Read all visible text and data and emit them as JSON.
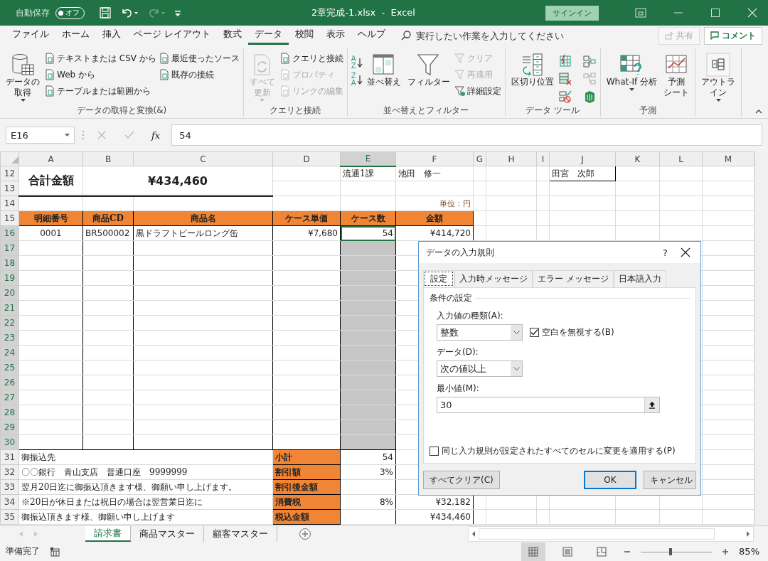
{
  "title_bar": {
    "autosave_label": "自動保存",
    "autosave_toggle": {
      "label": "オフ",
      "on": false
    },
    "title": "2章完成-1.xlsx  -  Excel",
    "signin": "サインイン"
  },
  "menu_tabs": [
    {
      "label": "ファイル",
      "selected": false
    },
    {
      "label": "ホーム",
      "selected": false
    },
    {
      "label": "挿入",
      "selected": false
    },
    {
      "label": "ページ レイアウト",
      "selected": false
    },
    {
      "label": "数式",
      "selected": false
    },
    {
      "label": "データ",
      "selected": true
    },
    {
      "label": "校閲",
      "selected": false
    },
    {
      "label": "表示",
      "selected": false
    },
    {
      "label": "ヘルプ",
      "selected": false
    }
  ],
  "tell_me": {
    "placeholder": "実行したい作業を入力してください"
  },
  "share_button": {
    "label": "共有",
    "disabled": true
  },
  "comment_button": {
    "label": "コメント"
  },
  "ribbon": {
    "groups": [
      {
        "label": "データの取得と変換(&)",
        "large": [
          {
            "lines": [
              "データの",
              "取得"
            ],
            "dropdown": true,
            "disabled": false
          }
        ],
        "small": [
          {
            "label": "テキストまたは CSV から",
            "disabled": false
          },
          {
            "label": "Web から",
            "disabled": false
          },
          {
            "label": "テーブルまたは範囲から",
            "disabled": false
          },
          {
            "label": "最近使ったソース",
            "disabled": false
          },
          {
            "label": "既存の接続",
            "disabled": false
          }
        ]
      },
      {
        "label": "クエリと接続",
        "large": [
          {
            "lines": [
              "すべて",
              "更新"
            ],
            "dropdown": true,
            "disabled": true
          }
        ],
        "small": [
          {
            "label": "クエリと接続",
            "disabled": false
          },
          {
            "label": "プロパティ",
            "disabled": true
          },
          {
            "label": "リンクの編集",
            "disabled": true
          }
        ]
      },
      {
        "label": "並べ替えとフィルター",
        "sort_buttons": [
          {
            "top": "A",
            "bottom": "Z"
          },
          {
            "top": "Z",
            "bottom": "A"
          }
        ],
        "large": [
          {
            "lines": [
              "並べ替え"
            ],
            "dropdown": false,
            "disabled": false
          },
          {
            "lines": [
              "フィルター"
            ],
            "dropdown": false,
            "disabled": false
          }
        ],
        "small": [
          {
            "label": "クリア",
            "disabled": true
          },
          {
            "label": "再適用",
            "disabled": true
          },
          {
            "label": "詳細設定",
            "disabled": false
          }
        ]
      },
      {
        "label": "データ ツール",
        "large": [
          {
            "lines": [
              "区切り位置"
            ],
            "dropdown": false,
            "disabled": false
          }
        ]
      },
      {
        "label": "予測",
        "large": [
          {
            "lines": [
              "What-If 分析"
            ],
            "dropdown": true,
            "disabled": false
          },
          {
            "lines": [
              "予測",
              "シート"
            ],
            "dropdown": false,
            "disabled": false
          }
        ]
      },
      {
        "large": [
          {
            "lines": [
              "アウトラ",
              "イン"
            ],
            "dropdown": true,
            "disabled": false
          }
        ]
      }
    ]
  },
  "formula_bar": {
    "name_box": "E16",
    "function_label": "fx",
    "value": "54"
  },
  "sheet": {
    "columns": [
      {
        "label": "A",
        "selected": false
      },
      {
        "label": "B",
        "selected": false
      },
      {
        "label": "C",
        "selected": false
      },
      {
        "label": "D",
        "selected": false
      },
      {
        "label": "E",
        "selected": true
      },
      {
        "label": "F",
        "selected": false
      },
      {
        "label": "G",
        "selected": false
      },
      {
        "label": "H",
        "selected": false
      },
      {
        "label": "I",
        "selected": false
      },
      {
        "label": "J",
        "selected": false
      },
      {
        "label": "K",
        "selected": false
      },
      {
        "label": "L",
        "selected": false
      },
      {
        "label": "M",
        "selected": false
      }
    ],
    "rows": [
      {
        "number": "12",
        "kind": "top",
        "title": "合計金額",
        "total": "¥434,460",
        "dept": "流通1課",
        "person": "池田　修一",
        "contact": "田宮　次郎",
        "selected": false
      },
      {
        "number": "13",
        "kind": "blank",
        "selected": false
      },
      {
        "number": "14",
        "kind": "unit",
        "unit": "単位：円",
        "selected": false
      },
      {
        "number": "15",
        "kind": "header",
        "cells": [
          "明細番号",
          "商品CD",
          "商品名",
          "ケース単価",
          "ケース数",
          "金額"
        ],
        "selected": false
      },
      {
        "number": "16",
        "kind": "item",
        "cells": [
          "0001",
          "BR500002",
          "黒ドラフトビールロング缶",
          "¥7,680",
          "54",
          "¥414,720"
        ],
        "selected": true
      },
      {
        "number": "17",
        "kind": "item",
        "selected": true
      },
      {
        "number": "18",
        "kind": "item",
        "selected": true
      },
      {
        "number": "19",
        "kind": "item",
        "selected": true
      },
      {
        "number": "20",
        "kind": "item",
        "selected": true
      },
      {
        "number": "21",
        "kind": "item",
        "selected": true
      },
      {
        "number": "22",
        "kind": "item",
        "selected": true
      },
      {
        "number": "23",
        "kind": "item",
        "selected": true
      },
      {
        "number": "24",
        "kind": "item",
        "selected": true
      },
      {
        "number": "25",
        "kind": "item",
        "selected": true
      },
      {
        "number": "26",
        "kind": "item",
        "selected": true
      },
      {
        "number": "27",
        "kind": "item",
        "selected": true
      },
      {
        "number": "28",
        "kind": "item",
        "selected": true
      },
      {
        "number": "29",
        "kind": "item",
        "selected": true
      },
      {
        "number": "30",
        "kind": "item",
        "selected": true
      },
      {
        "number": "31",
        "kind": "summary",
        "note": "御振込先",
        "label": "小計",
        "value": "54",
        "selected": false
      },
      {
        "number": "32",
        "kind": "summary",
        "note": "〇〇銀行　青山支店　普通口座　9999999",
        "label": "割引額",
        "value": "3%",
        "selected": false
      },
      {
        "number": "33",
        "kind": "summary",
        "note": "翌月20日迄に御振込頂きます様、御願い申し上げます。",
        "label": "割引後金額",
        "selected": false
      },
      {
        "number": "34",
        "kind": "summary",
        "note": "※20日が休日または祝日の場合は翌営業日迄に",
        "label": "消費税",
        "value": "8%",
        "amount": "¥32,182",
        "selected": false
      },
      {
        "number": "35",
        "kind": "summary",
        "note": "御振込頂きます様、御願い申し上げます",
        "label": "税込金額",
        "amount": "¥434,460",
        "selected": false
      }
    ]
  },
  "sheet_tabs": [
    {
      "label": "請求書",
      "selected": true
    },
    {
      "label": "商品マスター",
      "selected": false
    },
    {
      "label": "顧客マスター",
      "selected": false
    }
  ],
  "status_bar": {
    "status": "準備完了",
    "views": [
      {
        "selected": true
      },
      {
        "selected": false
      },
      {
        "selected": false
      }
    ],
    "zoom": {
      "level": 0.42,
      "reading": "85%"
    }
  },
  "dialog": {
    "title": "データの入力規則",
    "help": "?",
    "tabs": [
      {
        "label": "設定",
        "selected": true
      },
      {
        "label": "入力時メッセージ",
        "selected": false
      },
      {
        "label": "エラー メッセージ",
        "selected": false
      },
      {
        "label": "日本語入力",
        "selected": false
      }
    ],
    "section": "条件の設定",
    "allow": {
      "label": "入力値の種類(A):",
      "value": "整数"
    },
    "ignore_blank": {
      "label": "空白を無視する(B)",
      "checked": true
    },
    "data": {
      "label": "データ(D):",
      "value": "次の値以上"
    },
    "minimum": {
      "label": "最小値(M):",
      "value": "30"
    },
    "apply_all": {
      "label": "同じ入力規則が設定されたすべてのセルに変更を適用する(P)",
      "checked": false
    },
    "buttons": {
      "clear": "すべてクリア(C)",
      "ok": "OK",
      "cancel": "キャンセル"
    }
  }
}
